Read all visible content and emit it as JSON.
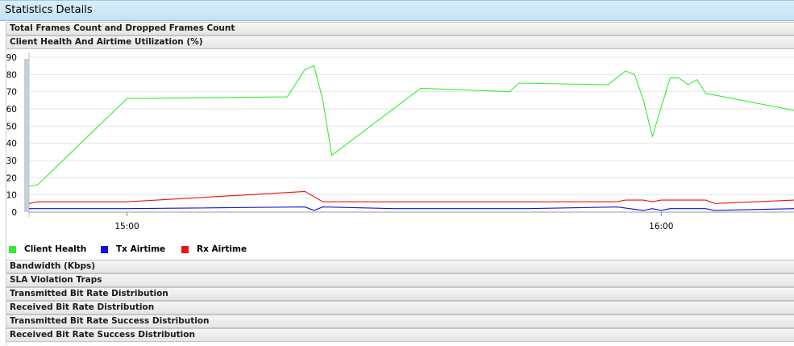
{
  "window": {
    "title": "Statistics Details"
  },
  "sections": {
    "frames": "Total Frames Count and Dropped Frames Count",
    "health": "Client Health And Airtime Utilization (%)",
    "bandwidth": "Bandwidth (Kbps)",
    "sla": "SLA Violation Traps",
    "tx_bitrate": "Transmitted Bit Rate Distribution",
    "rx_bitrate": "Received Bit Rate Distribution",
    "tx_success": "Transmitted Bit Rate Success Distribution",
    "rx_success": "Received Bit Rate Success Distribution"
  },
  "colors": {
    "client_health": "#33ee33",
    "tx_airtime": "#1111dd",
    "rx_airtime": "#ee1111"
  },
  "chart_data": {
    "type": "line",
    "title": "Client Health And Airtime Utilization (%)",
    "ylim": [
      0,
      90
    ],
    "yticks": [
      0,
      10,
      20,
      30,
      40,
      50,
      60,
      70,
      80,
      90
    ],
    "xlim": [
      "14:49",
      "16:15"
    ],
    "xticks": [
      "15:00",
      "16:00"
    ],
    "grid": true,
    "legend_position": "bottom-left",
    "series": [
      {
        "name": "Client Health",
        "color": "#33ee33",
        "x": [
          "14:49",
          "14:50",
          "15:00",
          "15:18",
          "15:20",
          "15:21",
          "15:22",
          "15:23",
          "15:33",
          "15:43",
          "15:44",
          "15:54",
          "15:55",
          "15:56",
          "15:57",
          "15:58",
          "15:59",
          "16:01",
          "16:02",
          "16:03",
          "16:04",
          "16:05",
          "16:06",
          "16:15"
        ],
        "values": [
          15,
          16,
          66,
          67,
          83,
          85,
          65,
          33,
          72,
          70,
          75,
          74,
          78,
          82,
          80,
          65,
          44,
          78,
          78,
          74,
          77,
          69,
          68,
          59
        ]
      },
      {
        "name": "Tx Airtime",
        "color": "#1111dd",
        "x": [
          "14:49",
          "14:50",
          "15:00",
          "15:20",
          "15:21",
          "15:22",
          "15:30",
          "15:45",
          "15:55",
          "15:58",
          "15:59",
          "16:00",
          "16:01",
          "16:05",
          "16:06",
          "16:15"
        ],
        "values": [
          2,
          2,
          2,
          3,
          1,
          3,
          2,
          2,
          3,
          1,
          2,
          1,
          2,
          2,
          1,
          2
        ]
      },
      {
        "name": "Rx Airtime",
        "color": "#ee1111",
        "x": [
          "14:49",
          "14:50",
          "15:00",
          "15:20",
          "15:22",
          "15:40",
          "15:55",
          "15:56",
          "15:58",
          "15:59",
          "16:00",
          "16:01",
          "16:05",
          "16:06",
          "16:15"
        ],
        "values": [
          5,
          6,
          6,
          12,
          6,
          6,
          6,
          7,
          7,
          6,
          7,
          7,
          7,
          5,
          7
        ]
      }
    ]
  }
}
